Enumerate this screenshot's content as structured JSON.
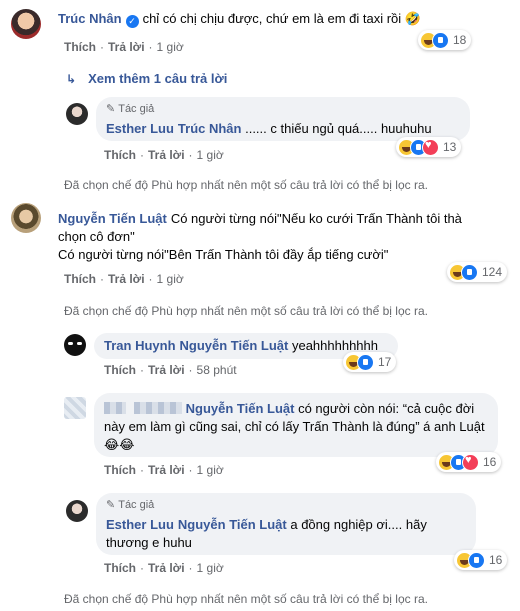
{
  "labels": {
    "like": "Thích",
    "reply": "Trả lời",
    "separator": "·",
    "author": "Tác giả",
    "filter_note": "Đã chọn chế độ Phù hợp nhất nên một số câu trả lời có thể bị lọc ra."
  },
  "c1": {
    "name": "Trúc Nhân",
    "text": "chỉ có chị chịu được, chứ em là em đi taxi rồi 🤣",
    "time": "1 giờ",
    "reactions": "18"
  },
  "more_replies": "Xem thêm 1 câu trả lời",
  "r1": {
    "name": "Esther Luu",
    "tag": "Trúc Nhân",
    "text": " ...... c thiếu ngủ quá..... huuhuhu",
    "time": "1 giờ",
    "reactions": "13"
  },
  "c2": {
    "name": "Nguyễn Tiến Luật",
    "line1": "Có người từng nói\"Nếu ko cưới Trấn Thành tôi thà chọn cô đơn\"",
    "line2": "Có người từng nói\"Bên Trấn Thành tôi đầy ắp tiếng cười\"",
    "time": "1 giờ",
    "reactions": "124"
  },
  "r2": {
    "name": "Tran Huynh",
    "tag": "Nguyễn Tiến Luật",
    "text": "yeahhhhhhhhh",
    "time": "58 phút",
    "reactions": "17"
  },
  "r3": {
    "tag": "Nguyễn Tiến Luật",
    "text": "có người còn nói: “cả cuộc đời này em làm gì cũng sai, chỉ có lấy Trấn Thành là đúng” á anh Luật 😂😂",
    "time": "1 giờ",
    "reactions": "16"
  },
  "r4": {
    "name": "Esther Luu",
    "tag": "Nguyễn Tiến Luật",
    "text": "a đồng nghiệp ơi.... hãy thương e huhu",
    "time": "1 giờ",
    "reactions": "16"
  },
  "colors": {
    "link": "#385898",
    "bubble": "#f0f2f5",
    "meta": "#65676b"
  }
}
